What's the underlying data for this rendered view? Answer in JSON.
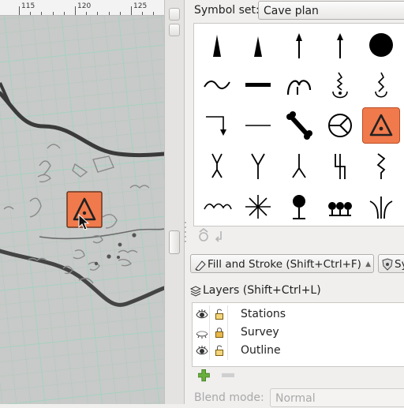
{
  "ruler": {
    "ticks": [
      "115",
      "120",
      "125"
    ]
  },
  "symbols_panel": {
    "label": "Symbol set:",
    "selected_set": "Cave plan",
    "symbols": [
      "stalagmite-icon",
      "stalactite-icon",
      "arrow-up-icon",
      "arrow-up-small-icon",
      "pit-icon",
      "wave-icon",
      "bar-icon",
      "arch-icon",
      "spring-icon",
      "water-flow-icon",
      "step-arrow-icon",
      "line-icon",
      "bone-icon",
      "circle-cross-icon",
      "entrance-icon",
      "bifurcate-icon",
      "y-junction-icon",
      "lambda-icon",
      "zigzag-icon",
      "helix-icon",
      "squiggle-icon",
      "asterisk-icon",
      "tree-icon",
      "cluster-icon",
      "fork-icon"
    ],
    "selected_symbol": "entrance-icon"
  },
  "dock": {
    "tab1": "Fill and Stroke (Shift+Ctrl+F)",
    "tab2": "Sy"
  },
  "layers": {
    "title": "Layers (Shift+Ctrl+L)",
    "items": [
      {
        "name": "Stations",
        "visible": true,
        "locked": false
      },
      {
        "name": "Survey",
        "visible": false,
        "locked": true
      },
      {
        "name": "Outline",
        "visible": true,
        "locked": false
      }
    ]
  },
  "blend": {
    "label": "Blend mode:",
    "value": "Normal"
  },
  "colors": {
    "accent": "#f07a4c",
    "grid": "#9fd3c1"
  }
}
